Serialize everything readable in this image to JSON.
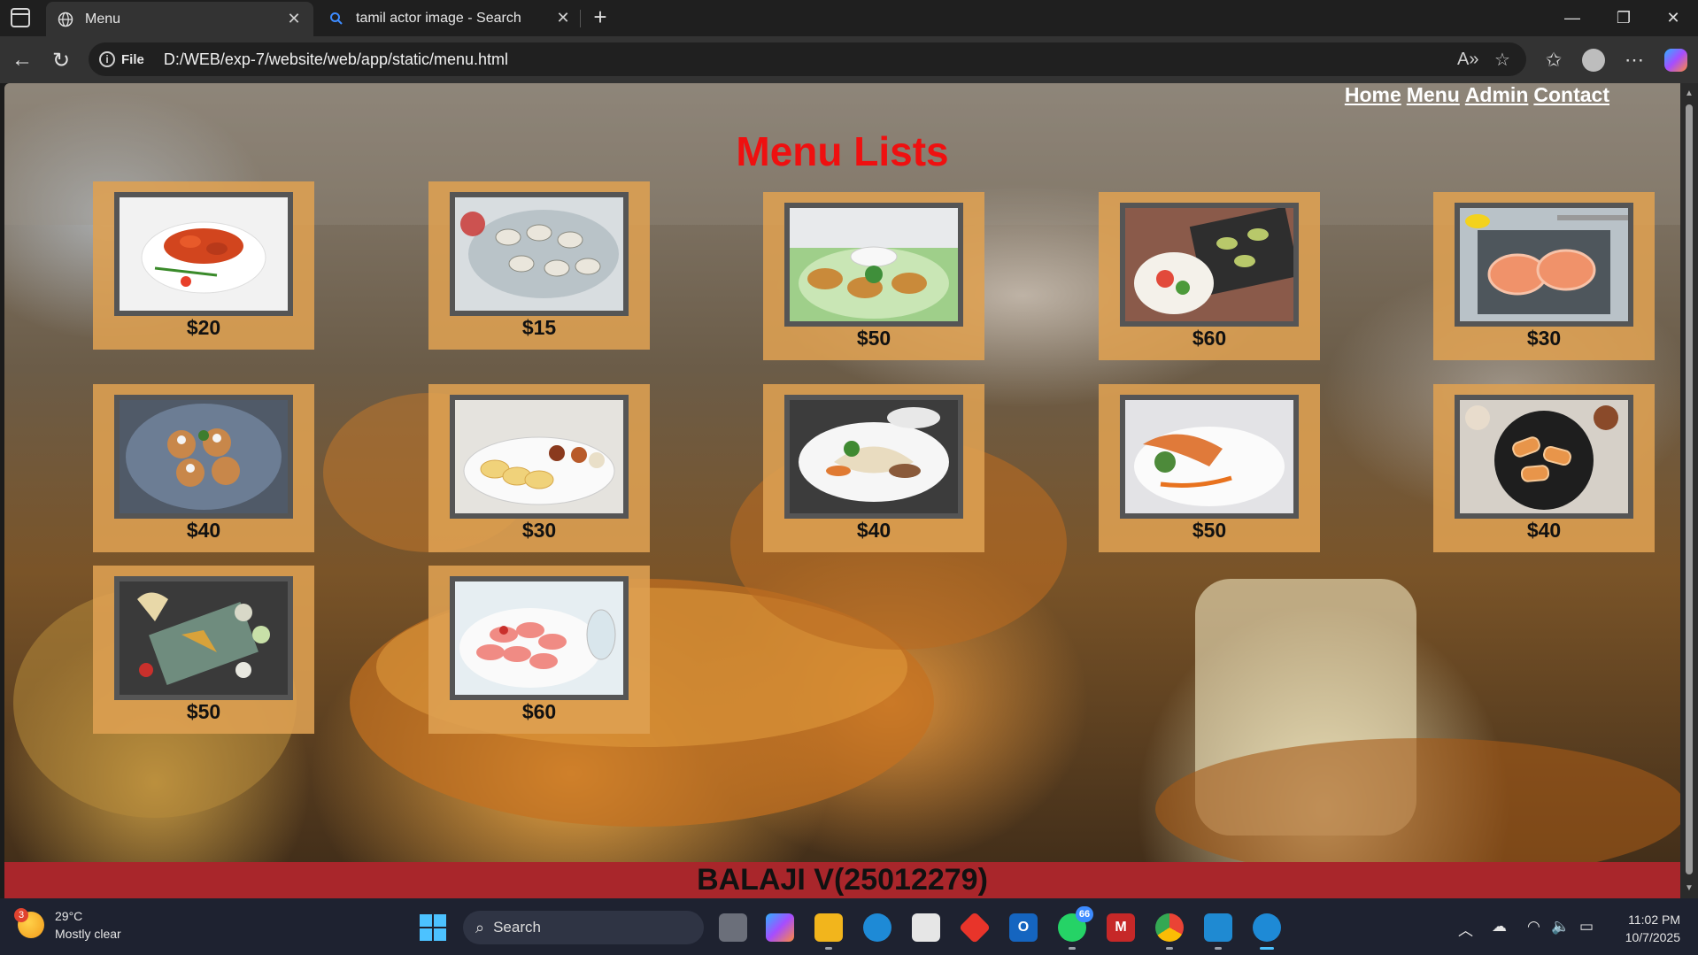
{
  "browser": {
    "tabs": [
      {
        "title": "Menu",
        "icon": "globe-icon",
        "active": true
      },
      {
        "title": "tamil actor image - Search",
        "icon": "search-icon",
        "active": false
      }
    ],
    "address": {
      "scheme_label": "File",
      "url": "D:/WEB/exp-7/website/web/app/static/menu.html"
    }
  },
  "page": {
    "nav": [
      {
        "label": "Home"
      },
      {
        "label": "Menu"
      },
      {
        "label": "Admin"
      },
      {
        "label": "Contact"
      }
    ],
    "title": "Menu Lists",
    "items": [
      {
        "price": "$20",
        "dish": "shrimp plate"
      },
      {
        "price": "$15",
        "dish": "oysters"
      },
      {
        "price": "$50",
        "dish": "fritters with dip"
      },
      {
        "price": "$60",
        "dish": "platter"
      },
      {
        "price": "$30",
        "dish": "salmon steaks"
      },
      {
        "price": "$40",
        "dish": "croquettes"
      },
      {
        "price": "$30",
        "dish": "pancakes"
      },
      {
        "price": "$40",
        "dish": "wrap plate"
      },
      {
        "price": "$50",
        "dish": "salmon fillet"
      },
      {
        "price": "$40",
        "dish": "rolls in bowl"
      },
      {
        "price": "$50",
        "dish": "fried fish with sauces"
      },
      {
        "price": "$60",
        "dish": "prawns"
      }
    ],
    "footer": "BALAJI V(25012279)",
    "colors": {
      "title": "#ef1010",
      "card": "#dea052",
      "footer": "#a9262b"
    }
  },
  "taskbar": {
    "weather": {
      "temp": "29°C",
      "condition": "Mostly clear",
      "badge": "3"
    },
    "search_label": "Search",
    "whatsapp_badge": "66",
    "time": "11:02 PM",
    "date": "10/7/2025"
  }
}
